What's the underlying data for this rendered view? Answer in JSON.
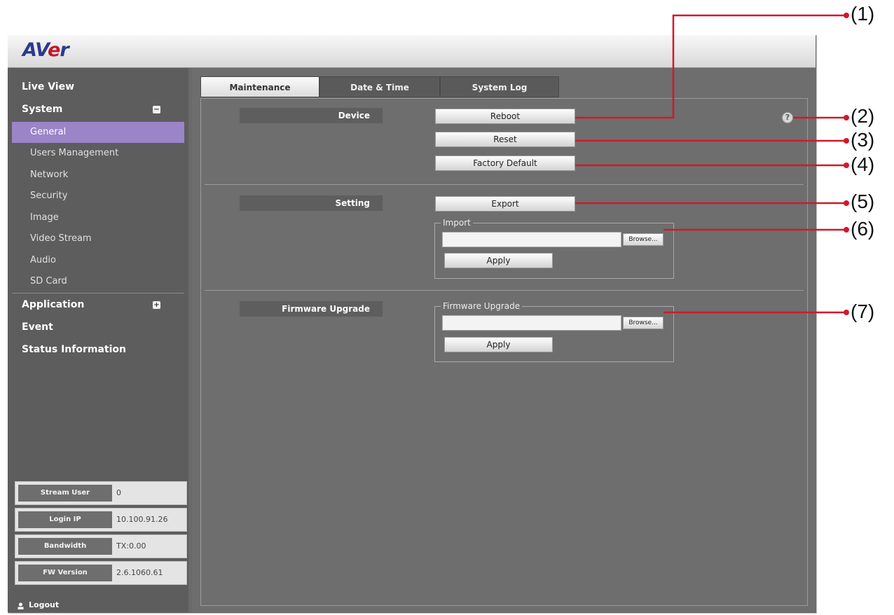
{
  "brand": {
    "logo_prefix": "AV",
    "logo_e": "e",
    "logo_suffix": "r"
  },
  "nav": {
    "live_view": "Live View",
    "system": "System",
    "system_toggle": "−",
    "system_items": [
      {
        "label": "General",
        "active": true
      },
      {
        "label": "Users Management"
      },
      {
        "label": "Network"
      },
      {
        "label": "Security"
      },
      {
        "label": "Image"
      },
      {
        "label": "Video Stream"
      },
      {
        "label": "Audio"
      },
      {
        "label": "SD Card"
      }
    ],
    "application": "Application",
    "application_toggle": "+",
    "event": "Event",
    "status_information": "Status Information"
  },
  "status": [
    {
      "key": "Stream User",
      "value": "0"
    },
    {
      "key": "Login IP",
      "value": "10.100.91.26"
    },
    {
      "key": "Bandwidth",
      "value": "TX:0.00"
    },
    {
      "key": "FW Version",
      "value": "2.6.1060.61"
    }
  ],
  "logout": {
    "icon": "user-icon",
    "label": "Logout"
  },
  "tabs": [
    {
      "label": "Maintenance",
      "active": true
    },
    {
      "label": "Date & Time"
    },
    {
      "label": "System Log"
    }
  ],
  "device": {
    "label": "Device",
    "reboot": "Reboot",
    "reset": "Reset",
    "factory_default": "Factory Default"
  },
  "setting": {
    "label": "Setting",
    "export": "Export",
    "import_legend": "Import",
    "import_value": "",
    "browse": "Browse...",
    "apply": "Apply"
  },
  "firmware": {
    "label": "Firmware Upgrade",
    "legend": "Firmware Upgrade",
    "file_value": "",
    "browse": "Browse...",
    "apply": "Apply"
  },
  "help": {
    "icon": "help-icon",
    "glyph": "?"
  },
  "callouts": [
    "(1)",
    "(2)",
    "(3)",
    "(4)",
    "(5)",
    "(6)",
    "(7)"
  ],
  "colors": {
    "callout_line": "#d0192b",
    "active_nav": "#9b84c8",
    "brand_blue": "#2b3a8f",
    "brand_red": "#c0192b"
  }
}
